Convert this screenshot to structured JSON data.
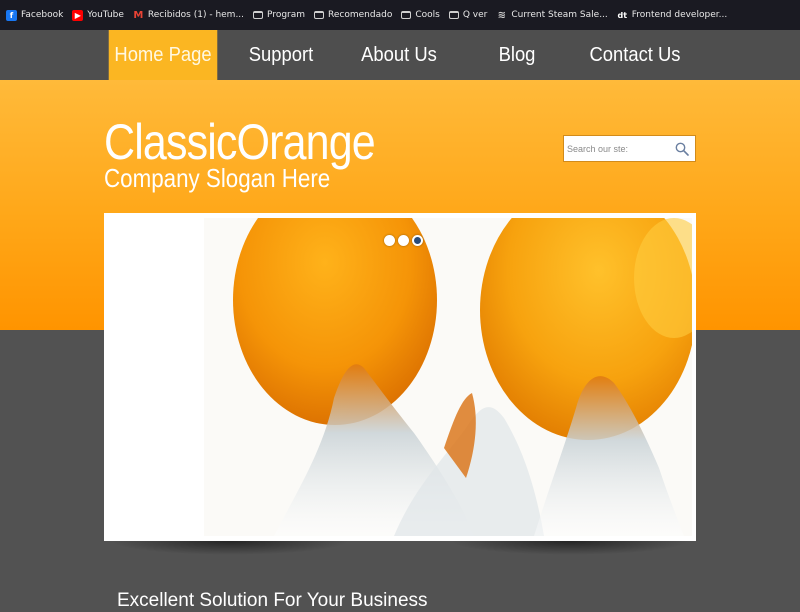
{
  "bookmarks": [
    {
      "label": "Facebook",
      "icon": "facebook-icon"
    },
    {
      "label": "YouTube",
      "icon": "youtube-icon"
    },
    {
      "label": "Recibidos (1) - hem...",
      "icon": "gmail-icon"
    },
    {
      "label": "Program",
      "icon": "folder-icon"
    },
    {
      "label": "Recomendado",
      "icon": "folder-icon"
    },
    {
      "label": "Cools",
      "icon": "folder-icon"
    },
    {
      "label": "Q ver",
      "icon": "folder-icon"
    },
    {
      "label": "Current Steam Sale...",
      "icon": "steam-icon"
    },
    {
      "label": "Frontend developer...",
      "icon": "dt-icon"
    }
  ],
  "nav": {
    "items": [
      {
        "label": "Home Page",
        "active": true
      },
      {
        "label": "Support",
        "active": false
      },
      {
        "label": "About Us",
        "active": false
      },
      {
        "label": "Blog",
        "active": false
      },
      {
        "label": "Contact Us",
        "active": false
      }
    ]
  },
  "header": {
    "logo": "ClassicOrange",
    "slogan": "Company Slogan Here"
  },
  "search": {
    "placeholder": "Search our ste:",
    "icon": "search-icon"
  },
  "slider": {
    "slide_count": 3,
    "active_index": 2
  },
  "content": {
    "tagline": "Excellent Solution For Your Business"
  },
  "colors": {
    "accent": "#fbb622",
    "band_top": "#ffba3a",
    "band_bottom": "#ff9400",
    "nav_bg": "#4e4e4e",
    "page_bg": "#525252"
  }
}
